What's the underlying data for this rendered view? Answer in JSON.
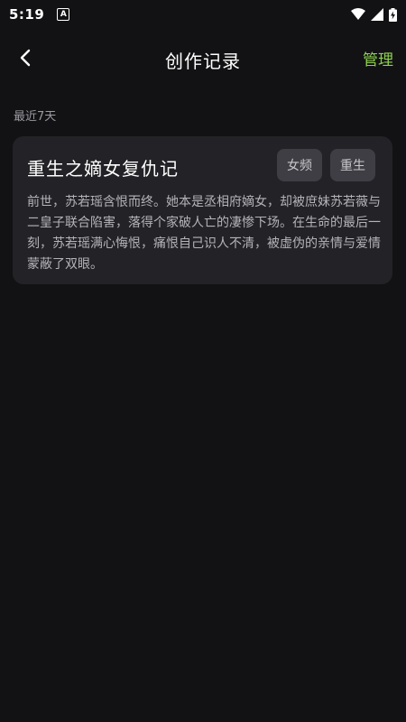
{
  "status_bar": {
    "time": "5:19",
    "app_icon_letter": "A",
    "icons": [
      "wifi-icon",
      "signal-icon",
      "battery-charging-icon"
    ]
  },
  "nav": {
    "back_icon": "chevron-left-icon",
    "title": "创作记录",
    "manage_label": "管理"
  },
  "section": {
    "label": "最近7天"
  },
  "records": [
    {
      "title": "重生之嫡女复仇记",
      "tags": [
        "女频",
        "重生"
      ],
      "description": "前世，苏若瑶含恨而终。她本是丞相府嫡女，却被庶妹苏若薇与二皇子联合陷害，落得个家破人亡的凄惨下场。在生命的最后一刻，苏若瑶满心悔恨，痛恨自己识人不清，被虚伪的亲情与爱情蒙蔽了双眼。"
    }
  ],
  "colors": {
    "background": "#121214",
    "card": "#232327",
    "accent": "#8fd14f",
    "tag_bg": "#3e3e44"
  }
}
